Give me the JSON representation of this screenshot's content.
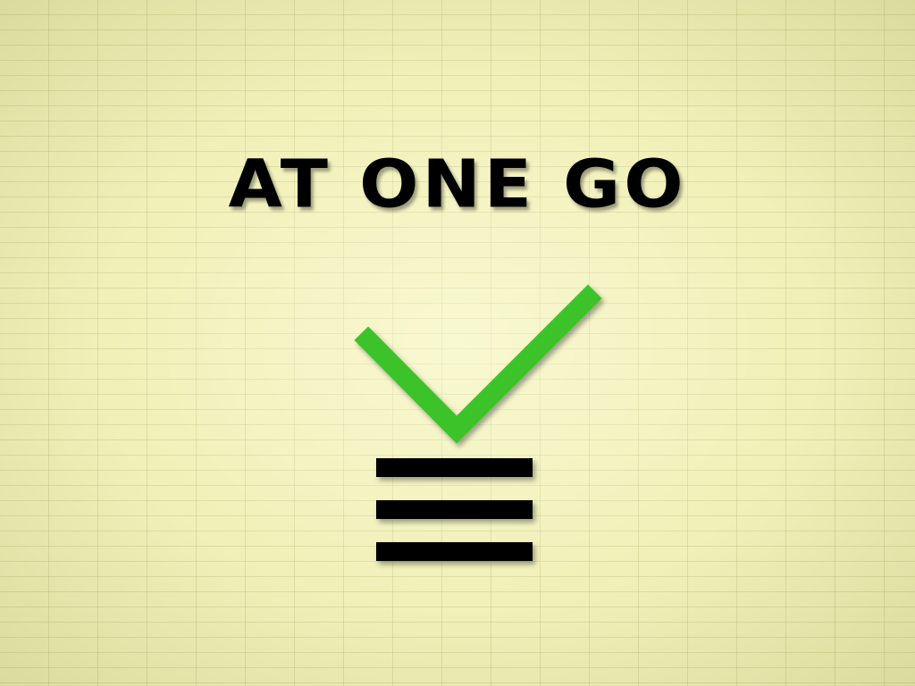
{
  "title": {
    "text": "AT ONE GO"
  },
  "colors": {
    "paper": "#f1f0b8",
    "grid_line": "#c9c78a",
    "check": "#3cc32a",
    "bars": "#000000",
    "title": "#000000"
  },
  "icons": {
    "check": "check-mark-icon",
    "list": "list-lines-icon"
  }
}
